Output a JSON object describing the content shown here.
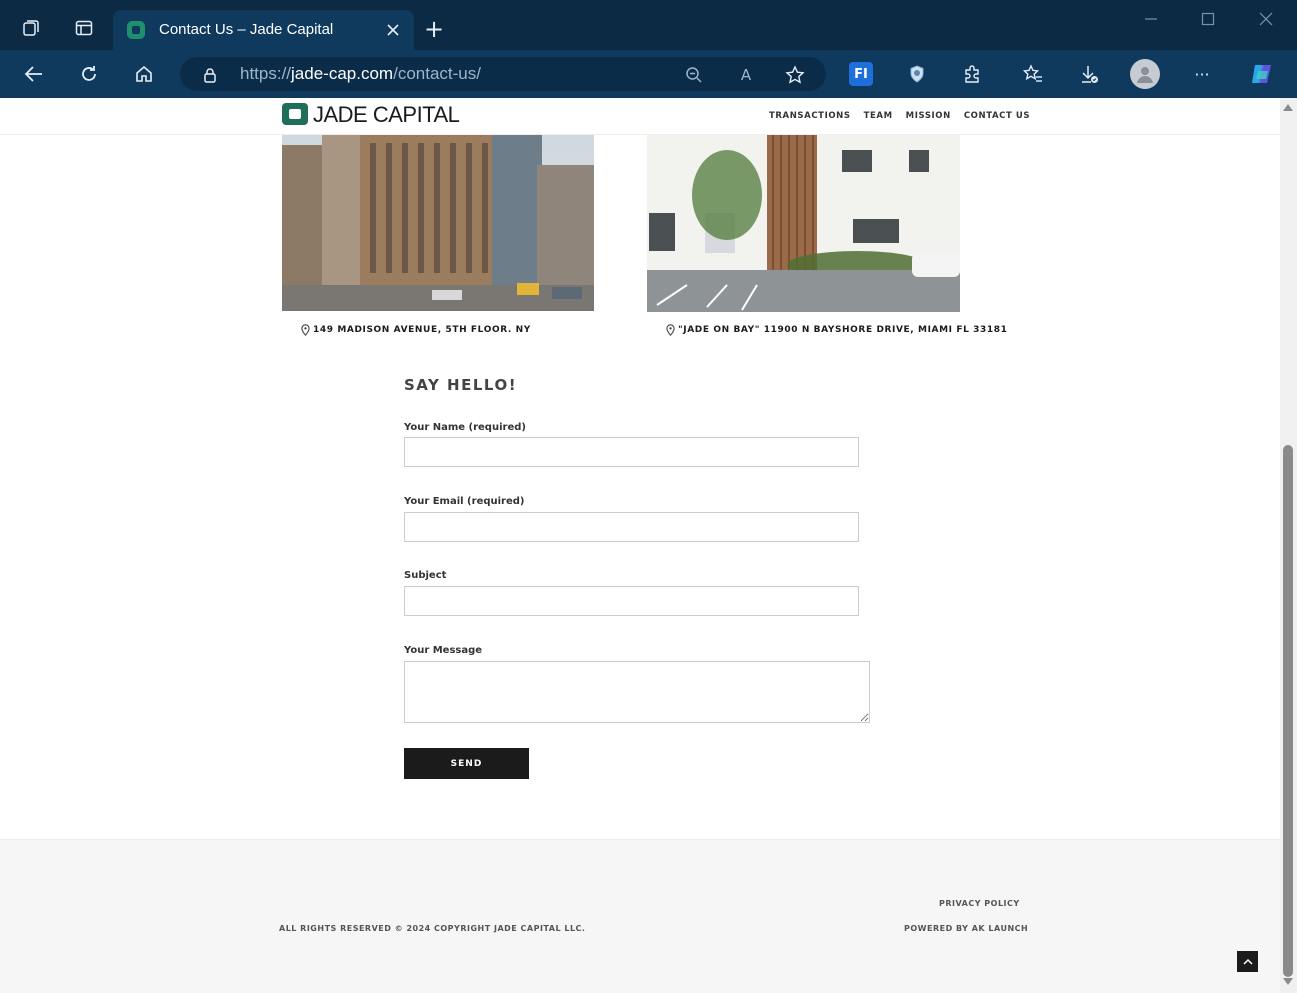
{
  "browser": {
    "tab_title": "Contact Us – Jade Capital",
    "url_prefix": "https://",
    "url_host": "jade-cap.com",
    "url_path": "/contact-us/",
    "new_tab_label": "+",
    "colors": {
      "tabbar": "#0c2a44",
      "toolbar": "#0f3a5e"
    }
  },
  "site": {
    "logo_text": "JADE CAPITAL",
    "nav": [
      "TRANSACTIONS",
      "TEAM",
      "MISSION",
      "CONTACT US"
    ]
  },
  "offices": [
    {
      "address": "149 MADISON AVENUE, 5TH FLOOR. NY"
    },
    {
      "address": "\"JADE ON BAY\" 11900 N BAYSHORE DRIVE, MIAMI FL 33181"
    }
  ],
  "form": {
    "title": "SAY HELLO!",
    "name_label": "Your Name (required)",
    "email_label": "Your Email (required)",
    "subject_label": "Subject",
    "message_label": "Your Message",
    "send_label": "SEND"
  },
  "footer": {
    "copyright": "ALL RIGHTS RESERVED © 2024 COPYRIGHT JADE CAPITAL LLC.",
    "privacy": "PRIVACY POLICY",
    "powered": "POWERED BY AK LAUNCH"
  }
}
